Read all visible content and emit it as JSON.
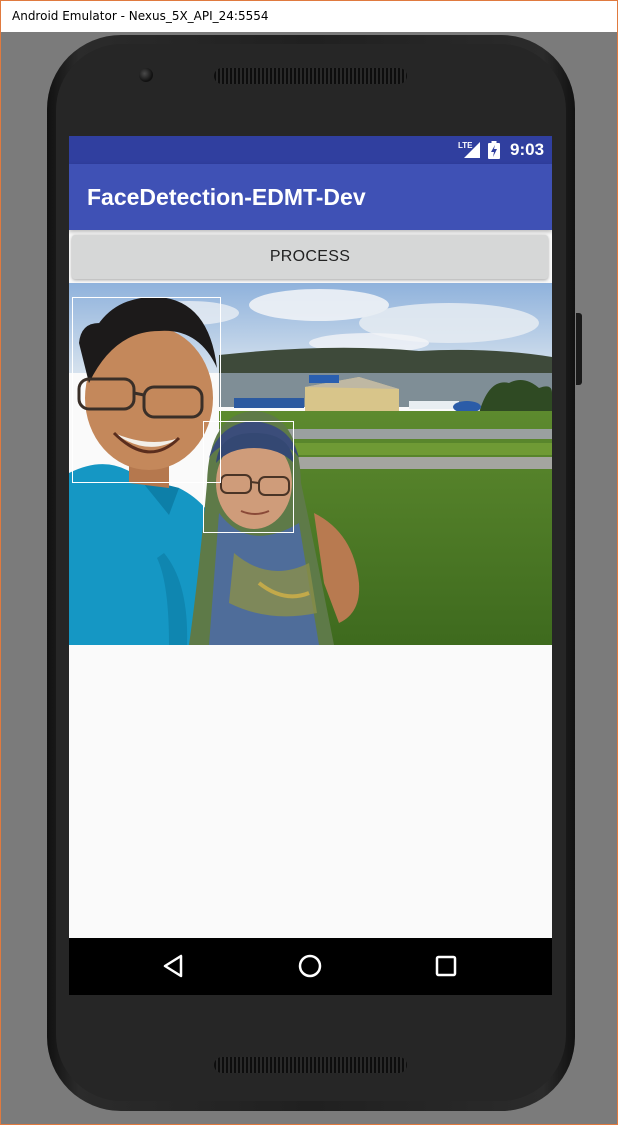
{
  "window": {
    "title": "Android Emulator - Nexus_5X_API_24:5554"
  },
  "status_bar": {
    "network_label": "LTE",
    "time": "9:03",
    "icons": [
      "lte-signal-icon",
      "battery-charging-icon"
    ]
  },
  "app_bar": {
    "title": "FaceDetection-EDMT-Dev"
  },
  "main": {
    "process_button_label": "PROCESS",
    "photo": {
      "description_icon": "selfie-photo",
      "detected_faces_count_shown": 2
    }
  },
  "nav_bar": {
    "icons": [
      "back-icon",
      "home-icon",
      "recent-apps-icon"
    ]
  },
  "colors": {
    "status_bar": "#303f9f",
    "app_bar": "#3f51b5",
    "button": "#d6d7d7",
    "screen_bg": "#fafafa",
    "face_box": "#ffffff"
  }
}
